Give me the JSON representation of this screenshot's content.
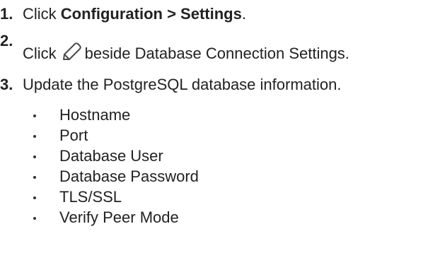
{
  "steps": [
    {
      "number": "1.",
      "prefix": "Click ",
      "bold": "Configuration > Settings",
      "suffix": "."
    },
    {
      "number": "2.",
      "prefix": "Click",
      "icon": "pencil-edit-icon",
      "suffix": "beside Database Connection Settings."
    },
    {
      "number": "3.",
      "text": "Update the PostgreSQL database information."
    }
  ],
  "fields": [
    "Hostname",
    "Port",
    "Database User",
    "Database Password",
    "TLS/SSL",
    "Verify Peer Mode"
  ],
  "colors": {
    "text": "#222222",
    "icon_stroke": "#4a4a4a"
  }
}
